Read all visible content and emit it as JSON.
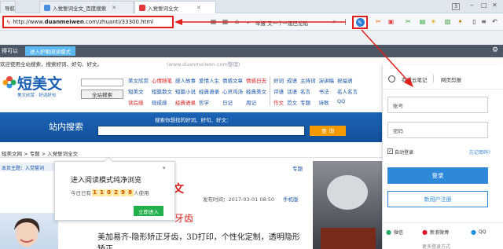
{
  "tabs": [
    {
      "label": "导航"
    },
    {
      "label": "入党誓词全文_百度搜索"
    },
    {
      "label": "入党誓词全文"
    }
  ],
  "address": {
    "prefix": "http://www.",
    "domain": "duanmeiwen",
    "suffix": ".com/zhuanti/33300.html"
  },
  "toolbar": {
    "search_label": "举报 又一个一姐已沦陷",
    "tab_count": "3"
  },
  "reading_bar": {
    "left_text": "得可以",
    "button_label": "进入护眼阅读模式"
  },
  "site": {
    "welcome": "欢迎使用全站搜索，搜索好词、好句、好文。",
    "watermark": "(www.duanmeiwen.com整理)",
    "logo_text": "短美文",
    "slogan": "美文欣赏 · 好词好句",
    "search_button": "全站搜索",
    "nav_col1": [
      "美文欣赏",
      "短美文",
      "读后感"
    ],
    "nav_col2": [
      "心情随笔",
      "短篇散文",
      "现成感"
    ],
    "nav_col3": [
      "感人故事",
      "短篇小说",
      "经典语录"
    ],
    "nav_col4": [
      "爱情人生",
      "经典语录",
      "哲学"
    ],
    "nav_col5": [
      "情感文章",
      "心灵鸡汤",
      "日记"
    ],
    "nav_col6": [
      "情感日志",
      "经典美文",
      "周记"
    ],
    "nav_col7": [
      "好词",
      "评语",
      "作文"
    ],
    "nav_col8": [
      "成语",
      "话语",
      "范文"
    ],
    "nav_col9": [
      "主持词",
      "名言",
      "专题"
    ],
    "nav_col10": [
      "演讲稿",
      "书法",
      "诗歌"
    ],
    "nav_col11": [
      "祝福语",
      "名人名言",
      "QQ"
    ]
  },
  "search_banner": {
    "title": "站内搜索",
    "hint": "搜索你想找的好词、好句、好文：",
    "button": "查 询"
  },
  "breadcrumb": "短美文网 > 专题 > 入党誓词全文",
  "left_tag": "本页主题：入党誓词",
  "topic_label": "专题",
  "article": {
    "meta": "发布时间：2017-03-01 08:50",
    "mobile": "手机版",
    "title_tail": "文",
    "headline_tail": "牙齿",
    "body": "美加易齐-隐形矫正牙齿，3D打印，个性化定制，透明隐形",
    "body2": "矫正"
  },
  "popup": {
    "title": "进入阅读模式纯净浏览",
    "pre": "今日已有",
    "digits": [
      "1",
      "1",
      "0",
      "2",
      "9",
      "8"
    ],
    "post": "人使用",
    "button": "立即进入"
  },
  "panel": {
    "tab1": "有道云笔记",
    "tab2": "网页剪报",
    "account_placeholder": "账号",
    "password_placeholder": "密码",
    "auto_login": "自动登录",
    "forgot": "忘记密码?",
    "login": "登录",
    "register": "新用户注册",
    "social": [
      "微信",
      "新浪微博",
      "QQ"
    ],
    "more": "更多登录方式"
  }
}
